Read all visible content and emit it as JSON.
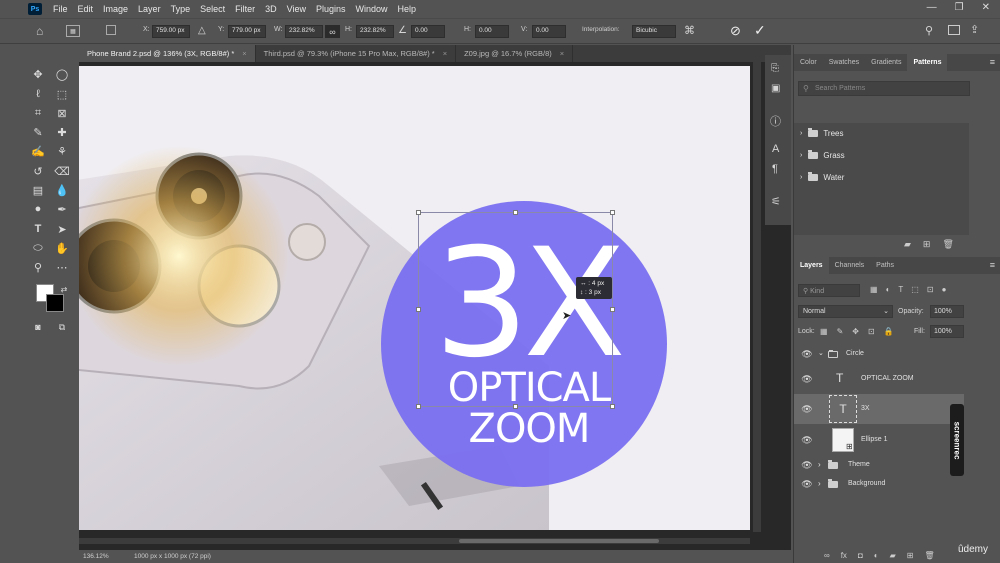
{
  "app": {
    "logo": "Ps"
  },
  "menu": [
    "File",
    "Edit",
    "Image",
    "Layer",
    "Type",
    "Select",
    "Filter",
    "3D",
    "View",
    "Plugins",
    "Window",
    "Help"
  ],
  "options": {
    "x_label": "X:",
    "x_value": "759.00 px",
    "y_label": "Y:",
    "y_value": "779.00 px",
    "w_label": "W:",
    "w_value": "232.82%",
    "h_label": "H:",
    "h_value": "232.82%",
    "angle_value": "0.00",
    "hskew_label": "H:",
    "hskew_value": "0.00",
    "vskew_label": "V:",
    "vskew_value": "0.00",
    "interp_label": "Interpolation:",
    "interp_value": "Bicubic"
  },
  "tabs": [
    {
      "label": "Phone Brand 2.psd @ 136% (3X, RGB/8#) *",
      "close": "×"
    },
    {
      "label": "Third.psd @ 79.3% (iPhone 15 Pro Max, RGB/8#) *",
      "close": "×"
    },
    {
      "label": "Z09.jpg @ 16.7% (RGB/8)",
      "close": "×"
    }
  ],
  "canvas": {
    "big_text": "3X",
    "line1": "OPTICAL",
    "line2": "ZOOM",
    "tooltip_line1": "↔ : 4 px",
    "tooltip_line2": "↕ : 3 px",
    "circle_color": "#7a6ff0"
  },
  "status": {
    "zoom": "136.12%",
    "doc_size": "1000 px x 1000 px (72 ppi)"
  },
  "patterns_panel": {
    "tabs": [
      "Color",
      "Swatches",
      "Gradients",
      "Patterns"
    ],
    "search_placeholder": "Search Patterns",
    "groups": [
      "Trees",
      "Grass",
      "Water"
    ]
  },
  "layers_panel": {
    "tabs": [
      "Layers",
      "Channels",
      "Paths"
    ],
    "filter_label": "Kind",
    "blend_mode": "Normal",
    "opacity_label": "Opacity:",
    "opacity_value": "100%",
    "lock_label": "Lock:",
    "fill_label": "Fill:",
    "fill_value": "100%",
    "layers": [
      {
        "name": "Circle",
        "type": "group-open"
      },
      {
        "name": "OPTICAL ZOOM",
        "type": "text"
      },
      {
        "name": "3X",
        "type": "text"
      },
      {
        "name": "Ellipse 1",
        "type": "shape"
      },
      {
        "name": "Theme",
        "type": "group"
      },
      {
        "name": "Background",
        "type": "group"
      }
    ]
  },
  "overlay": {
    "screenrec": "screenrec",
    "udemy": "ûdemy"
  }
}
